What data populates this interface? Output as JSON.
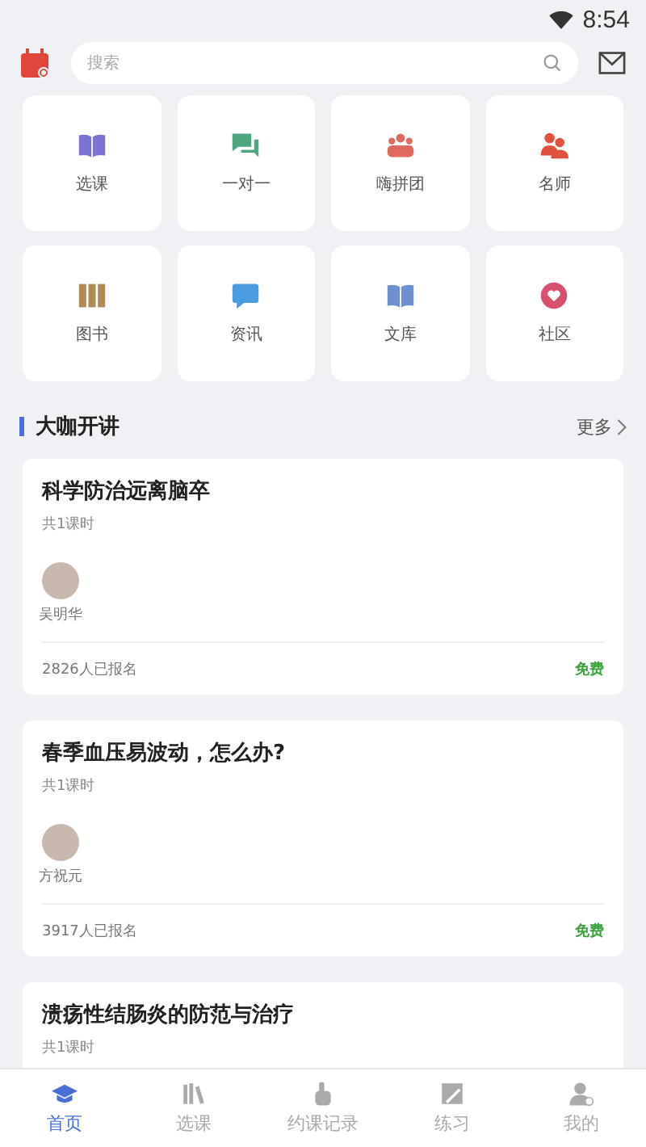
{
  "status_bar": {
    "time": "8:54"
  },
  "search": {
    "placeholder": "搜索"
  },
  "shortcuts": [
    {
      "label": "选课"
    },
    {
      "label": "一对一"
    },
    {
      "label": "嗨拼团"
    },
    {
      "label": "名师"
    },
    {
      "label": "图书"
    },
    {
      "label": "资讯"
    },
    {
      "label": "文库"
    },
    {
      "label": "社区"
    }
  ],
  "section": {
    "title": "大咖开讲",
    "more": "更多"
  },
  "courses": [
    {
      "title": "科学防治远离脑卒",
      "lessons": "共1课时",
      "teacher": "吴明华",
      "enrolled": "2826人已报名",
      "price": "免费"
    },
    {
      "title": "春季血压易波动，怎么办?",
      "lessons": "共1课时",
      "teacher": "方祝元",
      "enrolled": "3917人已报名",
      "price": "免费"
    },
    {
      "title": "溃疡性结肠炎的防范与治疗",
      "lessons": "共1课时"
    }
  ],
  "tab_bar": [
    {
      "label": "首页",
      "selected": true
    },
    {
      "label": "选课",
      "selected": false
    },
    {
      "label": "约课记录",
      "selected": false
    },
    {
      "label": "练习",
      "selected": false
    },
    {
      "label": "我的",
      "selected": false
    }
  ]
}
